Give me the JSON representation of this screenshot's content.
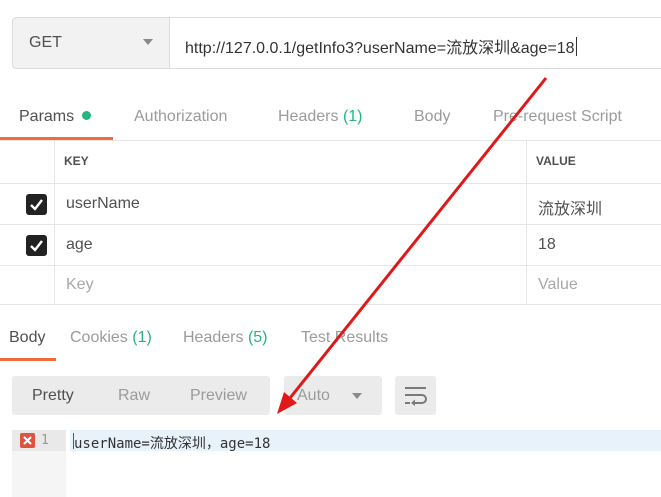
{
  "request": {
    "method": "GET",
    "url": "http://127.0.0.1/getInfo3?userName=流放深圳&age=18"
  },
  "request_tabs": {
    "params": "Params",
    "authorization": "Authorization",
    "headers": "Headers",
    "headers_count": "(1)",
    "body": "Body",
    "prerequest": "Pre-request Script"
  },
  "params": {
    "key_header": "KEY",
    "value_header": "VALUE",
    "rows": [
      {
        "key": "userName",
        "value": "流放深圳",
        "checked": true
      },
      {
        "key": "age",
        "value": "18",
        "checked": true
      }
    ],
    "key_placeholder": "Key",
    "value_placeholder": "Value"
  },
  "response_tabs": {
    "body": "Body",
    "cookies": "Cookies",
    "cookies_count": "(1)",
    "headers": "Headers",
    "headers_count": "(5)",
    "test_results": "Test Results"
  },
  "response_view": {
    "modes": [
      "Pretty",
      "Raw",
      "Preview"
    ],
    "selected_mode": "Pretty",
    "format": "Auto"
  },
  "response_body": {
    "line_number": "1",
    "content": "userName=流放深圳，age=18"
  },
  "colors": {
    "accent": "#f26b3a",
    "count_green": "#26b47f",
    "annotation_arrow": "#e01818",
    "error_marker": "#e0533e"
  }
}
